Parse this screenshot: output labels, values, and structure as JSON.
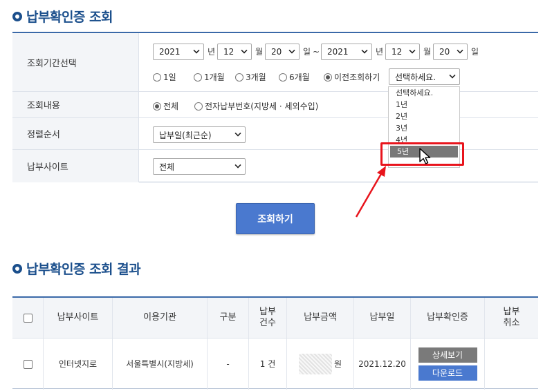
{
  "section1": {
    "title": "납부확인증 조회"
  },
  "search": {
    "period_label": "조회기간선택",
    "from": {
      "year": "2021",
      "month": "12",
      "day": "20"
    },
    "to": {
      "year": "2021",
      "month": "12",
      "day": "20"
    },
    "units": {
      "year": "년",
      "month": "월",
      "day": "일",
      "tilde": "~"
    },
    "period_options": [
      {
        "label": "1일",
        "checked": false
      },
      {
        "label": "1개월",
        "checked": false
      },
      {
        "label": "3개월",
        "checked": false
      },
      {
        "label": "6개월",
        "checked": false
      },
      {
        "label": "이전조회하기",
        "checked": true
      }
    ],
    "prev_select_value": "선택하세요.",
    "prev_dropdown_options": [
      "선택하세요.",
      "1년",
      "2년",
      "3년",
      "4년",
      "5년"
    ],
    "prev_dropdown_highlighted": "5년",
    "content_label": "조회내용",
    "content_options": [
      {
        "label": "전체",
        "checked": true
      },
      {
        "label": "전자납부번호(지방세 · 세외수입)",
        "checked": false
      }
    ],
    "sort_label": "정렬순서",
    "sort_value": "납부일(최근순)",
    "site_label": "납부사이트",
    "site_value": "전체",
    "button_label": "조회하기"
  },
  "section2": {
    "title": "납부확인증 조회 결과"
  },
  "results": {
    "columns": [
      "납부사이트",
      "이용기관",
      "구분",
      "납부\n건수",
      "납부금액",
      "납부일",
      "납부확인증",
      "납부\n취소"
    ],
    "rows": [
      {
        "site": "인터넷지로",
        "agency": "서울특별시(지방세)",
        "type": "-",
        "count": "1 건",
        "amount_unit": "원",
        "date": "2021.12.20",
        "detail_button": "상세보기",
        "download_button": "다운로드"
      }
    ]
  },
  "colors": {
    "brand": "#1b4f8c",
    "button": "#4a79cf",
    "highlight": "#e8141c"
  }
}
